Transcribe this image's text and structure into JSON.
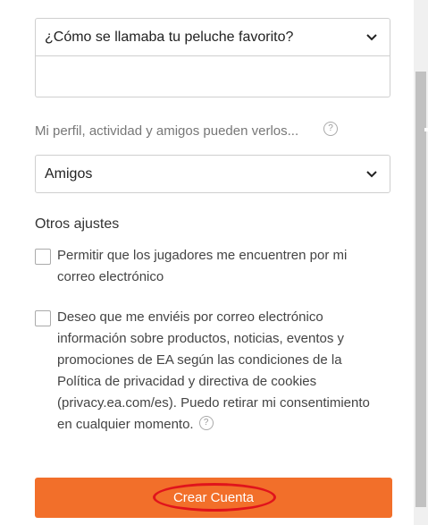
{
  "security_question": {
    "selected": "¿Cómo se llamaba tu peluche favorito?",
    "answer_value": ""
  },
  "profile_visibility": {
    "label": "Mi perfil, actividad y amigos pueden verlos...",
    "selected": "Amigos",
    "help_glyph": "?"
  },
  "other_settings": {
    "title": "Otros ajustes",
    "options": [
      {
        "label": "Permitir que los jugadores me encuentren por mi correo electrónico",
        "checked": false
      },
      {
        "label": "Deseo que me enviéis por correo electrónico información sobre productos, noticias, eventos y promociones de EA según las condiciones de la Política de privacidad y directiva de cookies (privacy.ea.com/es). Puedo retirar mi consentimiento en cualquier momento.",
        "checked": false,
        "help_glyph": "?"
      }
    ]
  },
  "actions": {
    "create_account_label": "Crear Cuenta"
  },
  "colors": {
    "accent": "#f26f2a",
    "annotation_ring": "#e0141c"
  },
  "icons": [
    "chevron-down-icon",
    "help-icon",
    "checkbox-icon"
  ]
}
